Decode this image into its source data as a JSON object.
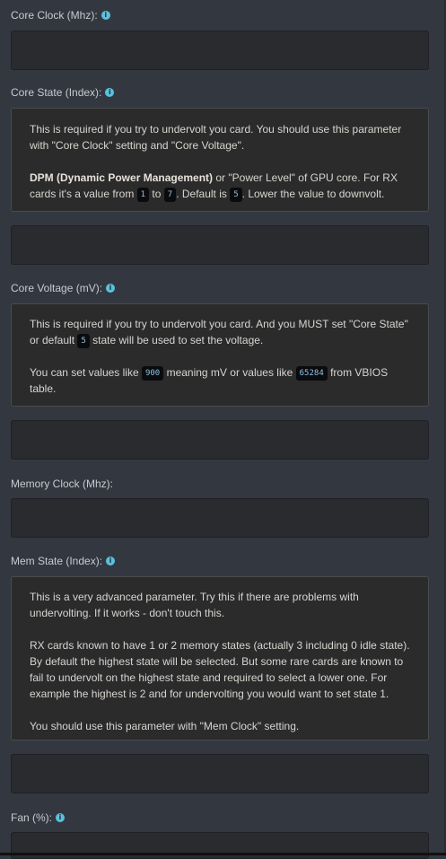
{
  "core_clock": {
    "label": "Core Clock (Mhz):",
    "value": ""
  },
  "core_state": {
    "label": "Core State (Index):",
    "note_p1": "This is required if you try to undervolt you card. You should use this parameter with \"Core Clock\" setting and \"Core Voltage\".",
    "note_bold": "DPM (Dynamic Power Management)",
    "note_p2a": " or \"Power Level\" of GPU core. For RX cards it's a value from ",
    "code_min": "1",
    "note_p2b": " to ",
    "code_max": "7",
    "note_p2c": ". Default is ",
    "code_default": "5",
    "note_p2d": ". Lower the value to downvolt.",
    "value": ""
  },
  "core_voltage": {
    "label": "Core Voltage (mV):",
    "note_p1a": "This is required if you try to undervolt you card. And you MUST set \"Core State\" or default ",
    "code_state": "5",
    "note_p1b": " state will be used to set the voltage.",
    "note_p2a": "You can set values like ",
    "code_mv": "900",
    "note_p2b": " meaning mV or values like ",
    "code_vbios": "65284",
    "note_p2c": " from VBIOS table.",
    "value": ""
  },
  "memory_clock": {
    "label": "Memory Clock (Mhz):",
    "value": ""
  },
  "mem_state": {
    "label": "Mem State (Index):",
    "note_p1": "This is a very advanced parameter. Try this if there are problems with undervolting. If it works - don't touch this.",
    "note_p2": "RX cards known to have 1 or 2 memory states (actually 3 including 0 idle state). By default the highest state will be selected. But some rare cards are known to fail to undervolt on the highest state and required to select a lower one. For example the highest is 2 and for undervolting you would want to set state 1.",
    "note_p3": "You should use this parameter with \"Mem Clock\" setting.",
    "value": ""
  },
  "fan": {
    "label": "Fan (%):",
    "value": ""
  },
  "colors": {
    "background": "#333840",
    "input": "#2a2b2f",
    "note": "#2b2b2c",
    "info": "#5bc0de",
    "code_text": "#8ec3e8"
  },
  "icons": {
    "info": "info-circle-icon"
  }
}
